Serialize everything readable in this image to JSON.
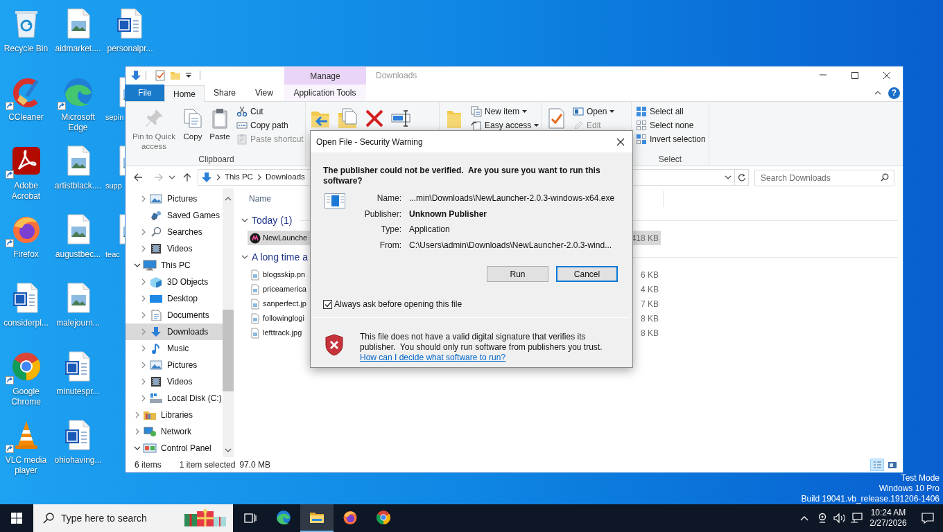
{
  "desktop_columns": [
    [
      {
        "label": "Recycle Bin",
        "kind": "recycle",
        "shortcut": false
      },
      {
        "label": "CCleaner",
        "kind": "ccleaner",
        "shortcut": true
      },
      {
        "label": "Adobe Acrobat",
        "kind": "acrobat",
        "shortcut": true
      },
      {
        "label": "Firefox",
        "kind": "firefox",
        "shortcut": true
      },
      {
        "label": "considerpl...",
        "kind": "word",
        "shortcut": false
      },
      {
        "label": "Google Chrome",
        "kind": "chrome",
        "shortcut": true
      },
      {
        "label": "VLC media player",
        "kind": "vlc",
        "shortcut": true
      }
    ],
    [
      {
        "label": "aidmarket....",
        "kind": "image",
        "shortcut": false
      },
      {
        "label": "Microsoft Edge",
        "kind": "edge",
        "shortcut": true
      },
      {
        "label": "artistblack....",
        "kind": "image",
        "shortcut": false
      },
      {
        "label": "augustbec...",
        "kind": "image",
        "shortcut": false
      },
      {
        "label": "malejourn...",
        "kind": "image",
        "shortcut": false
      },
      {
        "label": "minutespr...",
        "kind": "word",
        "shortcut": false
      },
      {
        "label": "ohiohaving...",
        "kind": "word",
        "shortcut": false
      }
    ],
    [
      {
        "label": "personalpr...",
        "kind": "word",
        "shortcut": false
      },
      {
        "label": "sepin",
        "kind": "image",
        "shortcut": false
      },
      {
        "label": "supp",
        "kind": "image",
        "shortcut": false
      },
      {
        "label": "teac",
        "kind": "image",
        "shortcut": false
      }
    ]
  ],
  "explorer": {
    "title": "Downloads",
    "context_group": "Manage",
    "help_button": "?",
    "tabs": [
      {
        "label": "File",
        "kind": "file",
        "selected": false
      },
      {
        "label": "Home",
        "kind": "tab",
        "selected": true
      },
      {
        "label": "Share",
        "kind": "tab",
        "selected": false
      },
      {
        "label": "View",
        "kind": "tab",
        "selected": false
      },
      {
        "label": "Application Tools",
        "kind": "context",
        "selected": false
      }
    ],
    "ribbon": [
      {
        "label": "Clipboard",
        "large": [
          {
            "kind": "pin",
            "label": "Pin to Quick access",
            "disabled": true
          },
          {
            "kind": "copy",
            "label": "Copy",
            "disabled": false
          },
          {
            "kind": "paste",
            "label": "Paste",
            "disabled": false
          }
        ],
        "small": [
          {
            "kind": "cut",
            "label": "Cut",
            "disabled": false,
            "dropdown": false
          },
          {
            "kind": "copypath",
            "label": "Copy path",
            "disabled": false,
            "dropdown": false
          },
          {
            "kind": "pasteshortcut",
            "label": "Paste shortcut",
            "disabled": true,
            "dropdown": false
          }
        ]
      },
      {
        "large": [
          {
            "kind": "moveto",
            "disabled": false
          },
          {
            "kind": "copyto",
            "disabled": false
          },
          {
            "kind": "delete",
            "disabled": false
          },
          {
            "kind": "rename",
            "disabled": false
          }
        ]
      },
      {
        "large": [
          {
            "kind": "newfolder",
            "disabled": false
          }
        ],
        "small": [
          {
            "kind": "newitem",
            "label": "New item",
            "disabled": false,
            "dropdown": true
          },
          {
            "kind": "easyaccess",
            "label": "Easy access",
            "disabled": false,
            "dropdown": true
          }
        ]
      },
      {
        "large": [
          {
            "kind": "properties",
            "disabled": false
          }
        ],
        "small": [
          {
            "kind": "open",
            "label": "Open",
            "disabled": false,
            "dropdown": true
          },
          {
            "kind": "edit",
            "label": "Edit",
            "disabled": true,
            "dropdown": false
          }
        ]
      },
      {
        "label": "Select",
        "small": [
          {
            "kind": "selectall",
            "label": "Select all",
            "disabled": false,
            "dropdown": false
          },
          {
            "kind": "selectnone",
            "label": "Select none",
            "disabled": false,
            "dropdown": false
          },
          {
            "kind": "invert",
            "label": "Invert selection",
            "disabled": false,
            "dropdown": false
          }
        ]
      }
    ],
    "address": {
      "crumbs": [
        "This PC",
        "Downloads"
      ]
    },
    "search": {
      "placeholder": "Search Downloads"
    },
    "nav": [
      {
        "children": [
          {
            "label": "Pictures",
            "kind": "pictures",
            "expandable": true,
            "expanded": false,
            "selected": false
          },
          {
            "label": "Saved Games",
            "kind": "games",
            "expandable": false,
            "expanded": false,
            "selected": false
          },
          {
            "label": "Searches",
            "kind": "search",
            "expandable": true,
            "expanded": false,
            "selected": false
          },
          {
            "label": "Videos",
            "kind": "videos",
            "expandable": true,
            "expanded": false,
            "selected": false
          }
        ]
      },
      {
        "label": "This PC",
        "kind": "pc",
        "expandable": true,
        "expanded": true,
        "selected": false,
        "children": [
          {
            "label": "3D Objects",
            "kind": "objects",
            "expandable": true,
            "expanded": false,
            "selected": false
          },
          {
            "label": "Desktop",
            "kind": "desktop",
            "expandable": true,
            "expanded": false,
            "selected": false
          },
          {
            "label": "Documents",
            "kind": "documents",
            "expandable": true,
            "expanded": false,
            "selected": false
          },
          {
            "label": "Downloads",
            "kind": "downloads",
            "expandable": true,
            "expanded": false,
            "selected": true
          },
          {
            "label": "Music",
            "kind": "music",
            "expandable": true,
            "expanded": false,
            "selected": false
          },
          {
            "label": "Pictures",
            "kind": "pictures",
            "expandable": true,
            "expanded": false,
            "selected": false
          },
          {
            "label": "Videos",
            "kind": "videos",
            "expandable": true,
            "expanded": false,
            "selected": false
          },
          {
            "label": "Local Disk (C:)",
            "kind": "disk",
            "expandable": true,
            "expanded": false,
            "selected": false
          }
        ]
      },
      {
        "label": "Libraries",
        "kind": "libraries",
        "expandable": true,
        "expanded": false,
        "selected": false
      },
      {
        "label": "Network",
        "kind": "network",
        "expandable": true,
        "expanded": false,
        "selected": false
      },
      {
        "label": "Control Panel",
        "kind": "controlpanel",
        "expandable": true,
        "expanded": true,
        "selected": false
      }
    ],
    "columns": [
      "Name"
    ],
    "groups": [
      {
        "label": "Today (1)",
        "expanded": true,
        "files": [
          {
            "name": "NewLaunche",
            "size": "418 KB",
            "kind": "app",
            "selected": true
          }
        ]
      },
      {
        "label": "A long time a",
        "expanded": true,
        "files": [
          {
            "name": "blogsskip.pn",
            "size": "6 KB",
            "kind": "image",
            "selected": false
          },
          {
            "name": "priceamerica",
            "size": "4 KB",
            "kind": "image",
            "selected": false
          },
          {
            "name": "sanperfect.jp",
            "size": "7 KB",
            "kind": "image",
            "selected": false
          },
          {
            "name": "followinglogi",
            "size": "8 KB",
            "kind": "image",
            "selected": false
          },
          {
            "name": "lefttrack.jpg",
            "size": "8 KB",
            "kind": "image",
            "selected": false
          }
        ]
      }
    ],
    "status": {
      "count": "6 items",
      "selection": "1 item selected",
      "selection_size": "97.0 MB"
    },
    "views": [
      {
        "kind": "details",
        "selected": true
      },
      {
        "kind": "large",
        "selected": false
      }
    ]
  },
  "dialog": {
    "title": "Open File - Security Warning",
    "heading": "The publisher could not be verified.  Are you sure you want to run this software?",
    "fields": [
      {
        "label": "Name:",
        "value": "...min\\Downloads\\NewLauncher-2.0.3-windows-x64.exe",
        "emphasis": false
      },
      {
        "label": "Publisher:",
        "value": "Unknown Publisher",
        "emphasis": true
      },
      {
        "label": "Type:",
        "value": "Application",
        "emphasis": false
      },
      {
        "label": "From:",
        "value": "C:\\Users\\admin\\Downloads\\NewLauncher-2.0.3-wind...",
        "emphasis": false
      }
    ],
    "buttons": [
      {
        "label": "Run",
        "default": false
      },
      {
        "label": "Cancel",
        "default": true
      }
    ],
    "checkbox": {
      "label": "Always ask before opening this file",
      "checked": true
    },
    "warning": "This file does not have a valid digital signature that verifies its publisher.  You should only run software from publishers you trust.",
    "help_link": "How can I decide what software to run?"
  },
  "system_info": [
    "Test Mode",
    "Windows 10 Pro",
    "Build 19041.vb_release.191206-1406"
  ],
  "taskbar": {
    "search_placeholder": "Type here to search",
    "apps": [
      {
        "kind": "edge",
        "active": false
      },
      {
        "kind": "explorer",
        "active": true
      },
      {
        "kind": "firefox",
        "active": false
      },
      {
        "kind": "chrome",
        "active": false
      }
    ],
    "time": "10:24 AM",
    "date": "2/27/2026"
  }
}
